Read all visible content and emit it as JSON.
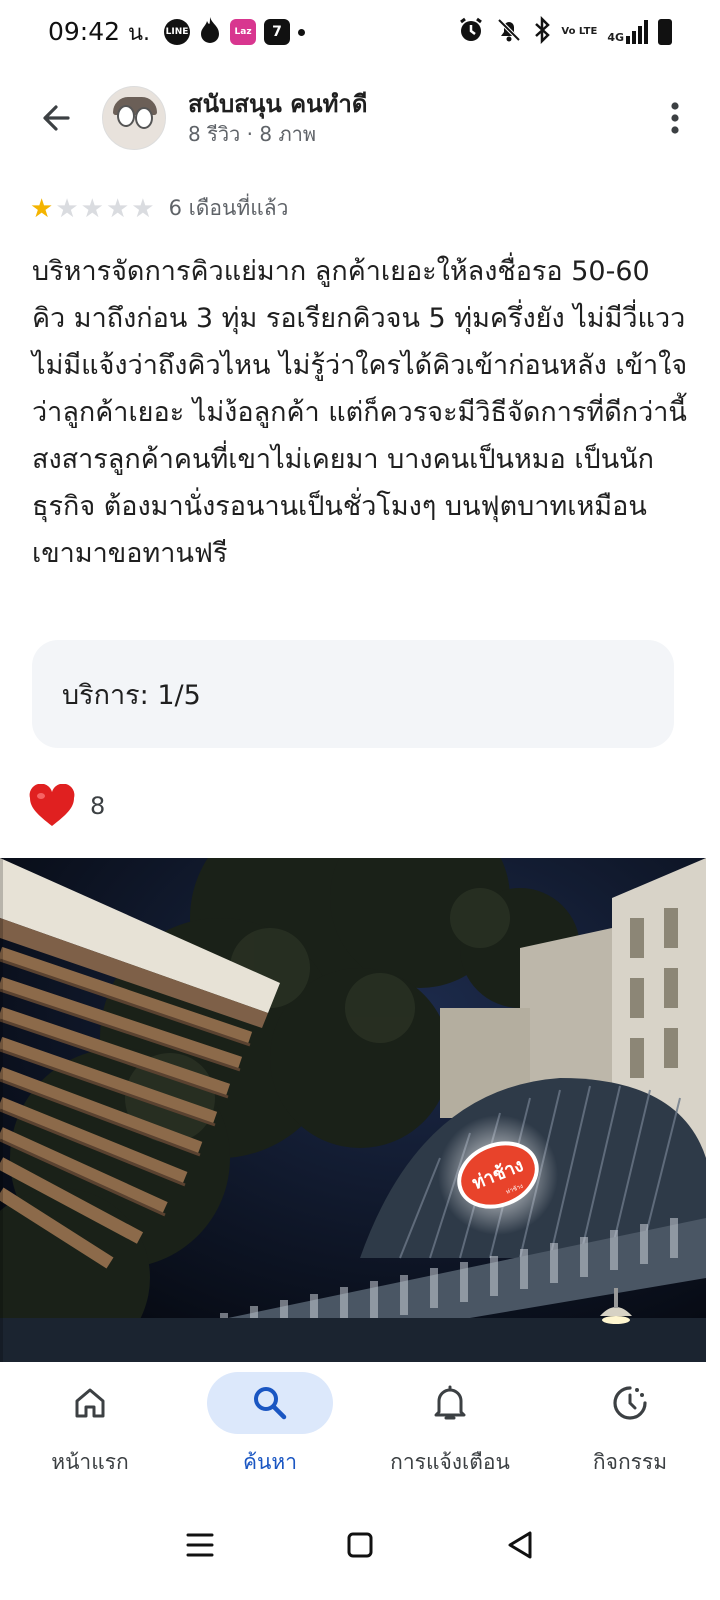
{
  "status_bar": {
    "time": "09:42",
    "time_suffix": "น.",
    "left_icons": [
      "line-icon",
      "flame-icon",
      "lazada-icon",
      "seven-eleven-icon",
      "dot-icon"
    ],
    "right_icons": [
      "alarm-icon",
      "mute-icon",
      "bluetooth-icon",
      "volte-icon",
      "4g-signal-icon",
      "battery-icon"
    ],
    "volte_label": "Vo LTE",
    "network_label": "4G"
  },
  "header": {
    "user_name": "สนับสนุน คนทำดี",
    "user_meta": "8 รีวิว · 8 ภาพ"
  },
  "review": {
    "rating": 1,
    "max_rating": 5,
    "date": "6 เดือนที่แล้ว",
    "text": "บริหารจัดการคิวแย่มาก ลูกค้าเยอะให้ลงชื่อรอ 50-60 คิว มาถึงก่อน 3 ทุ่ม รอเรียกคิวจน 5 ทุ่มครึ่งยัง ไม่มีวี่แวว ไม่มีแจ้งว่าถึงคิวไหน ไม่รู้ว่าใครได้คิวเข้าก่อนหลัง เข้าใจว่าลูกค้าเยอะ ไม่ง้อลูกค้า แต่ก็ควรจะมีวิธีจัดการที่ดีกว่านี้ สงสารลูกค้าคนที่เขาไม่เคยมา บางคนเป็นหมอ เป็นนักธุรกิจ ต้องมานั่งรอนานเป็นชั่วโมงๆ บนฟุตบาทเหมือนเขามาขอทานฟรี",
    "service_rating": "บริการ: 1/5",
    "like_count": "8",
    "photo_sign_text": "ท่าช้าง",
    "photo_sign_subtext": "ท่าช้าง"
  },
  "bottom_nav": {
    "items": [
      {
        "label": "หน้าแรก",
        "icon": "home-icon",
        "active": false
      },
      {
        "label": "ค้นหา",
        "icon": "search-icon",
        "active": true
      },
      {
        "label": "การแจ้งเตือน",
        "icon": "bell-icon",
        "active": false
      },
      {
        "label": "กิจกรรม",
        "icon": "activity-icon",
        "active": false
      }
    ]
  },
  "colors": {
    "accent": "#1a56c2",
    "active_pill": "#dce8fb",
    "star_on": "#f4b400",
    "star_off": "#dadce0",
    "heart": "#e02020",
    "sign": "#e8432b"
  }
}
